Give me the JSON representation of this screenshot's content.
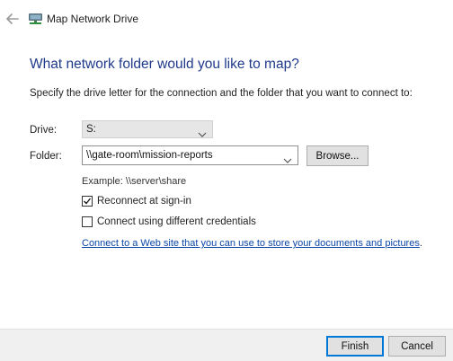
{
  "window": {
    "title": "Map Network Drive",
    "icons": {
      "back": "back-arrow-icon",
      "app": "network-drive-icon"
    }
  },
  "content": {
    "heading": "What network folder would you like to map?",
    "instructions": "Specify the drive letter for the connection and the folder that you want to connect to:",
    "drive": {
      "label": "Drive:",
      "value": "S:"
    },
    "folder": {
      "label": "Folder:",
      "value": "\\\\gate-room\\mission-reports",
      "browse_label": "Browse..."
    },
    "example": "Example: \\\\server\\share",
    "reconnect": {
      "label": "Reconnect at sign-in",
      "checked": true
    },
    "credentials": {
      "label": "Connect using different credentials",
      "checked": false
    },
    "web_link": {
      "text": "Connect to a Web site that you can use to store your documents and pictures",
      "suffix": "."
    }
  },
  "buttons": {
    "finish": "Finish",
    "cancel": "Cancel"
  },
  "colors": {
    "heading": "#1f3a8a",
    "link": "#0a46a8",
    "default_button_border": "#0078d7"
  }
}
